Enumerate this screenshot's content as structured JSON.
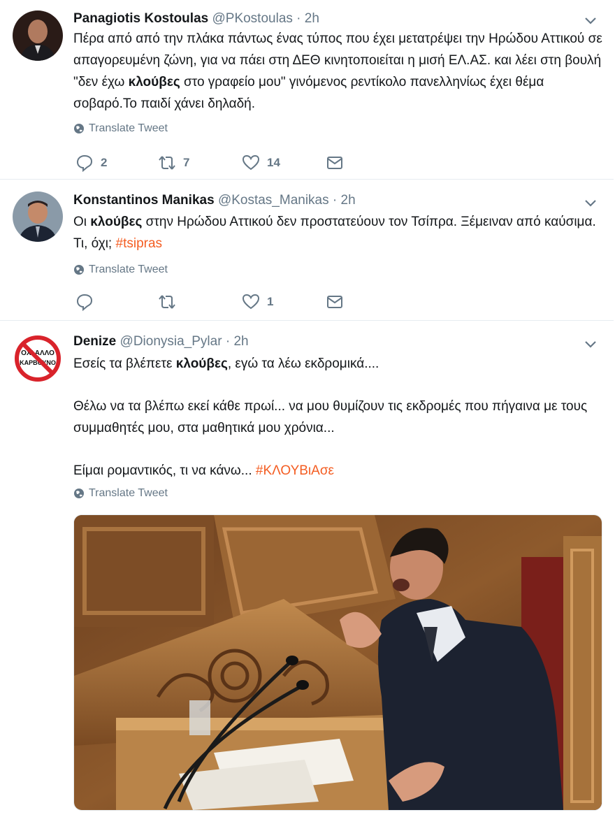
{
  "translate_label": "Translate Tweet",
  "tweets": [
    {
      "name": "Panagiotis Kostoulas",
      "handle": "@PKostoulas",
      "sep": "·",
      "time": "2h",
      "text_parts": [
        "Πέρα από από την πλάκα πάντως ένας τύπος που έχει μετατρέψει την Ηρώδου Αττικού σε απαγορευμένη ζώνη, για να πάει στη ΔΕΘ κινητοποιείται η μισή ΕΛ.ΑΣ. και λέει στη βουλή \"δεν έχω ",
        "κλούβες",
        " στο γραφείο μου\" γινόμενος ρεντίκολο πανελληνίως έχει θέμα σοβαρό.Το παιδί χάνει δηλαδή."
      ],
      "counts": {
        "reply": "2",
        "retweet": "7",
        "like": "14"
      }
    },
    {
      "name": "Konstantinos Manikas",
      "handle": "@Kostas_Manikas",
      "sep": "·",
      "time": "2h",
      "text_parts": [
        "Οι ",
        "κλούβες",
        " στην Ηρώδου Αττικού δεν προστατεύουν τον Τσίπρα. Ξέμειναν από καύσιμα. Τι, όχι; ",
        "#tsipras"
      ],
      "counts": {
        "reply": "",
        "retweet": "",
        "like": "1"
      }
    },
    {
      "name": "Denize",
      "handle": "@Dionysia_Pylar",
      "sep": "·",
      "time": "2h",
      "avatar_text": [
        "ΟΧΙ ΑΛΛΟ",
        "ΚΑΡΒΟΥΝΟ"
      ],
      "line1_parts": [
        "Εσείς τα βλέπετε ",
        "κλούβες",
        ", εγώ τα λέω εκδρομικά...."
      ],
      "para2": "Θέλω να τα βλέπω εκεί κάθε πρωί... να μου θυμίζουν τις εκδρομές που πήγαινα με τους συμμαθητές μου, στα μαθητικά μου χρόνια...",
      "para3_parts": [
        "Είμαι ρομαντικός, τι να κάνω... ",
        "#ΚΛΟΥΒιΑσε"
      ]
    }
  ]
}
